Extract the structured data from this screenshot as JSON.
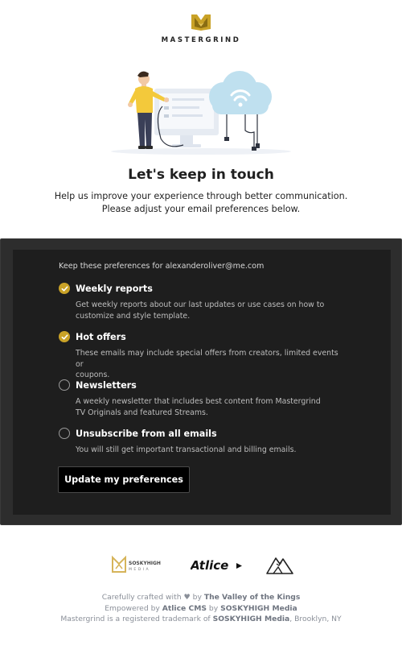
{
  "brand": {
    "name": "MASTERGRIND"
  },
  "hero": {
    "headline": "Let's keep in touch",
    "intro_line1": "Help us improve your experience through better communication.",
    "intro_line2": "Please adjust your email preferences below."
  },
  "preferences": {
    "note": "Keep these preferences for alexanderoliver@me.com",
    "options": [
      {
        "title": "Weekly reports",
        "checked": true,
        "desc_line1": "Get weekly reports about our last updates or use cases on how to",
        "desc_line2": "customize and style template."
      },
      {
        "title": "Hot offers",
        "checked": true,
        "desc_line1": "These emails may include special offers from creators, limited events or",
        "desc_line2": "coupons."
      },
      {
        "title": "Newsletters",
        "checked": false,
        "desc_line1": "A weekly newsletter that includes best content from Mastergrind",
        "desc_line2": "TV Originals and featured Streams."
      },
      {
        "title": "Unsubscribe from all emails",
        "checked": false,
        "desc_line1": "You will still get important transactional and billing emails.",
        "desc_line2": ""
      }
    ],
    "submit_label": "Update my preferences"
  },
  "partners": {
    "sosky_name": "SOSKYHIGH",
    "sosky_sub": "MEDIA",
    "atlice_name": "Atlice"
  },
  "footer": {
    "line1_prefix": "Carefully crafted with",
    "line1_by": "by",
    "line1_link": "The Valley of the Kings",
    "line2_prefix": "Empowered by",
    "line2_link1": "Atlice CMS",
    "line2_by": "by",
    "line2_link2": "SOSKYHIGH Media",
    "line3_prefix": "Mastergrind is a registered trademark of",
    "line3_link": "SOSKYHIGH Media",
    "line3_suffix": ", Brooklyn, NY"
  },
  "colors": {
    "accent": "#c9a227",
    "panel_bg": "#1e1e1e",
    "panel_frame": "#2d2d2d"
  },
  "icons": {
    "logo": "mastergrind-logo-icon",
    "checked": "check-circle-icon",
    "unchecked": "empty-circle-icon",
    "heart": "heart-icon"
  }
}
